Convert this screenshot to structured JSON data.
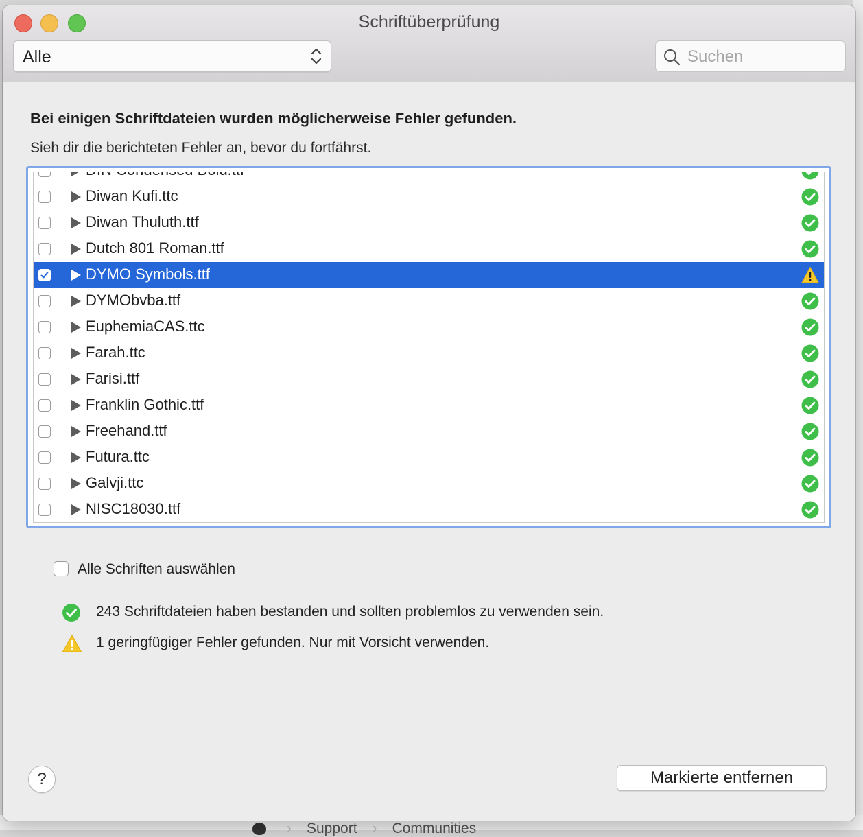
{
  "window": {
    "title": "Schriftüberprüfung"
  },
  "toolbar": {
    "filter_value": "Alle",
    "search_placeholder": "Suchen"
  },
  "header": {
    "heading": "Bei einigen Schriftdateien wurden möglicherweise Fehler gefunden.",
    "subheading": "Sieh dir die berichteten Fehler an, bevor du fortfährst."
  },
  "fonts": [
    {
      "name": "DIN Condensed Bold.ttf",
      "status": "ok",
      "checked": false,
      "selected": false
    },
    {
      "name": "Diwan Kufi.ttc",
      "status": "ok",
      "checked": false,
      "selected": false
    },
    {
      "name": "Diwan Thuluth.ttf",
      "status": "ok",
      "checked": false,
      "selected": false
    },
    {
      "name": "Dutch 801 Roman.ttf",
      "status": "ok",
      "checked": false,
      "selected": false
    },
    {
      "name": "DYMO Symbols.ttf",
      "status": "warning",
      "checked": true,
      "selected": true
    },
    {
      "name": "DYMObvba.ttf",
      "status": "ok",
      "checked": false,
      "selected": false
    },
    {
      "name": "EuphemiaCAS.ttc",
      "status": "ok",
      "checked": false,
      "selected": false
    },
    {
      "name": "Farah.ttc",
      "status": "ok",
      "checked": false,
      "selected": false
    },
    {
      "name": "Farisi.ttf",
      "status": "ok",
      "checked": false,
      "selected": false
    },
    {
      "name": "Franklin Gothic.ttf",
      "status": "ok",
      "checked": false,
      "selected": false
    },
    {
      "name": "Freehand.ttf",
      "status": "ok",
      "checked": false,
      "selected": false
    },
    {
      "name": "Futura.ttc",
      "status": "ok",
      "checked": false,
      "selected": false
    },
    {
      "name": "Galvji.ttc",
      "status": "ok",
      "checked": false,
      "selected": false
    },
    {
      "name": "NISC18030.ttf",
      "status": "ok",
      "checked": false,
      "selected": false
    }
  ],
  "select_all_label": "Alle Schriften auswählen",
  "summary": {
    "passed": "243 Schriftdateien haben bestanden und sollten problemlos zu verwenden sein.",
    "warnings": "1 geringfügiger Fehler gefunden. Nur mit Vorsicht verwenden."
  },
  "buttons": {
    "help": "?",
    "remove": "Markierte entfernen"
  },
  "background": {
    "breadcrumb": [
      "Support",
      "Communities"
    ]
  },
  "colors": {
    "selection": "#2567d9",
    "ok_green": "#3fbf4a",
    "warning_yellow": "#f6c728"
  }
}
